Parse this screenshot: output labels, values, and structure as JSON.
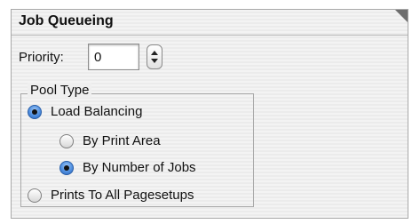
{
  "section": {
    "title": "Job Queueing"
  },
  "priority": {
    "label": "Priority:",
    "value": "0"
  },
  "pool_type": {
    "legend": "Pool Type",
    "options": [
      {
        "label": "Load Balancing",
        "selected": true
      },
      {
        "label": "By Print Area",
        "selected": false
      },
      {
        "label": "By Number of Jobs",
        "selected": true
      }
    ]
  },
  "prints_to_all": {
    "label": "Prints To All Pagesetups",
    "selected": false
  },
  "colors": {
    "radio_selected": "#4f8fe0",
    "panel_background": "#f0f0f0"
  },
  "icons": {
    "stepper": "up-down-stepper-icon",
    "corner": "panel-corner-icon"
  }
}
